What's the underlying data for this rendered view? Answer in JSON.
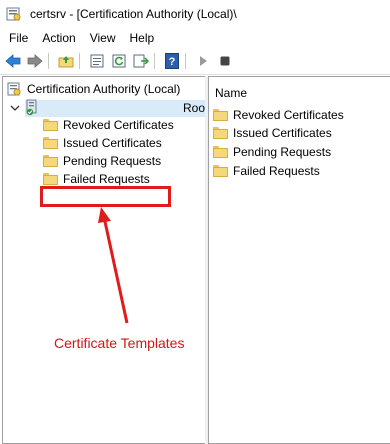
{
  "window": {
    "title": "certsrv - [Certification Authority (Local)\\"
  },
  "menu": [
    "File",
    "Action",
    "View",
    "Help"
  ],
  "toolbar": {
    "buttons": [
      "back-icon",
      "forward-icon",
      "up-folder-icon",
      "properties-icon",
      "refresh-icon",
      "export-list-icon",
      "help-icon",
      "start-service-icon",
      "stop-service-icon"
    ]
  },
  "tree": {
    "root_label": "Certification Authority (Local)",
    "ca_label": "Roo",
    "children": [
      "Revoked Certificates",
      "Issued Certificates",
      "Pending Requests",
      "Failed Requests"
    ]
  },
  "list": {
    "column_header": "Name",
    "items": [
      "Revoked Certificates",
      "Issued Certificates",
      "Pending Requests",
      "Failed Requests"
    ]
  },
  "annotation": {
    "label": "Certificate Templates",
    "color": "#d31515"
  }
}
